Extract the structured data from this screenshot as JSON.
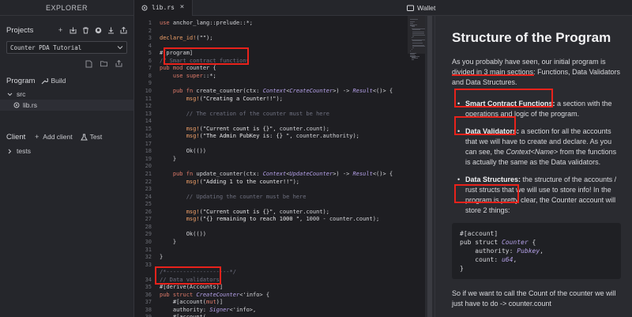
{
  "explorer": {
    "title": "EXPLORER",
    "projects_label": "Projects",
    "project_select": "Counter PDA Tutorial",
    "program_label": "Program",
    "build_label": "Build",
    "tree": {
      "src": "src",
      "lib": "lib.rs",
      "tests": "tests"
    },
    "client_label": "Client",
    "add_client_label": "Add client",
    "test_label": "Test"
  },
  "editor": {
    "tab_label": "lib.rs",
    "lines": [
      {
        "n": "1",
        "code": "use anchor_lang::prelude::*;"
      },
      {
        "n": "2",
        "code": ""
      },
      {
        "n": "3",
        "code": "declare_id!(\"\");"
      },
      {
        "n": "4",
        "code": ""
      },
      {
        "n": "5",
        "code": "#[program]"
      },
      {
        "n": "6",
        "code": "// Smart contract functions"
      },
      {
        "n": "7",
        "code": "pub mod counter {"
      },
      {
        "n": "8",
        "code": "    use super::*;"
      },
      {
        "n": "9",
        "code": ""
      },
      {
        "n": "10",
        "code": "    pub fn create_counter(ctx: Context<CreateCounter>) -> Result<()> {"
      },
      {
        "n": "11",
        "code": "        msg!(\"Creating a Counter!!\");"
      },
      {
        "n": "12",
        "code": ""
      },
      {
        "n": "13",
        "code": "        // The creation of the counter must be here"
      },
      {
        "n": "14",
        "code": ""
      },
      {
        "n": "15",
        "code": "        msg!(\"Current count is {}\", counter.count);"
      },
      {
        "n": "16",
        "code": "        msg!(\"The Admin PubKey is: {} \", counter.authority);"
      },
      {
        "n": "17",
        "code": ""
      },
      {
        "n": "18",
        "code": "        Ok(())"
      },
      {
        "n": "19",
        "code": "    }"
      },
      {
        "n": "20",
        "code": ""
      },
      {
        "n": "21",
        "code": "    pub fn update_counter(ctx: Context<UpdateCounter>) -> Result<()> {"
      },
      {
        "n": "22",
        "code": "        msg!(\"Adding 1 to the counter!!\");"
      },
      {
        "n": "23",
        "code": ""
      },
      {
        "n": "24",
        "code": "        // Updating the counter must be here"
      },
      {
        "n": "25",
        "code": ""
      },
      {
        "n": "26",
        "code": "        msg!(\"Current count is {}\", counter.count);"
      },
      {
        "n": "27",
        "code": "        msg!(\"{} remaining to reach 1000 \", 1000 - counter.count);"
      },
      {
        "n": "28",
        "code": ""
      },
      {
        "n": "29",
        "code": "        Ok(())"
      },
      {
        "n": "30",
        "code": "    }"
      },
      {
        "n": "31",
        "code": ""
      },
      {
        "n": "32",
        "code": "}"
      },
      {
        "n": "33",
        "code": ""
      },
      {
        "n": "",
        "code": "/*-------------------*/"
      },
      {
        "n": "34",
        "code": "// Data validators"
      },
      {
        "n": "35",
        "code": "#[derive(Accounts)]"
      },
      {
        "n": "36",
        "code": "pub struct CreateCounter<'info> {"
      },
      {
        "n": "37",
        "code": "    #[account(mut)]"
      },
      {
        "n": "38",
        "code": "    authority: Signer<'info>,"
      },
      {
        "n": "39",
        "code": "    #[account("
      }
    ]
  },
  "wallet": {
    "label": "Wallet"
  },
  "tutorial": {
    "title": "Structure of the Program",
    "intro_1": "As you probably have seen, our initial program is ",
    "intro_highlight": "divided in 3 main sections",
    "intro_2": ": Functions, Data Validators and Data Structures.",
    "items": [
      {
        "term": "Smart Contract Functions:",
        "text": " a section with the operations and logic of the program."
      },
      {
        "term": "Data Validators:",
        "text": " a section for all the accounts that we will have to create and declare. As you can see, the "
      },
      {
        "term": "Data Structures:",
        "text": " the structure of the accounts / rust structs that we will use to store info! In the program is pretty clear, the Counter account will store 2 things:"
      }
    ],
    "item2_em": "Context<Name>",
    "item2_tail": " from the functions is actually the same as the Data validators.",
    "code_block": {
      "l1": "#[account]",
      "l2a": "pub struct ",
      "l2b": "Counter",
      "l2c": " {",
      "l3a": "    authority: ",
      "l3b": "Pubkey",
      "l3c": ",",
      "l4a": "    count: ",
      "l4b": "u64",
      "l4c": ",",
      "l5": "}"
    },
    "outro": "So if we want to call the Count of the counter we will just have to do -> counter.count"
  },
  "colors": {
    "annotation": "#e8221b",
    "keyword": "#e07b6a",
    "type": "#b4a0e8"
  }
}
